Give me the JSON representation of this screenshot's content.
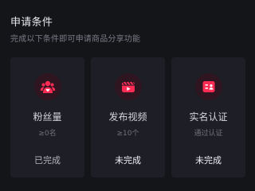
{
  "header": {
    "title": "申请条件",
    "subtitle": "完成以下条件即可申请商品分享功能"
  },
  "cards": [
    {
      "icon": "fans-icon",
      "name": "粉丝量",
      "requirement": "≥0名",
      "status": "已完成"
    },
    {
      "icon": "video-icon",
      "name": "发布视频",
      "requirement": "≥10个",
      "status": "未完成"
    },
    {
      "icon": "id-card-icon",
      "name": "实名认证",
      "requirement": "通过认证",
      "status": "未完成"
    }
  ],
  "colors": {
    "background": "#141519",
    "card": "#1e1f26",
    "accent": "#fe2c55"
  }
}
